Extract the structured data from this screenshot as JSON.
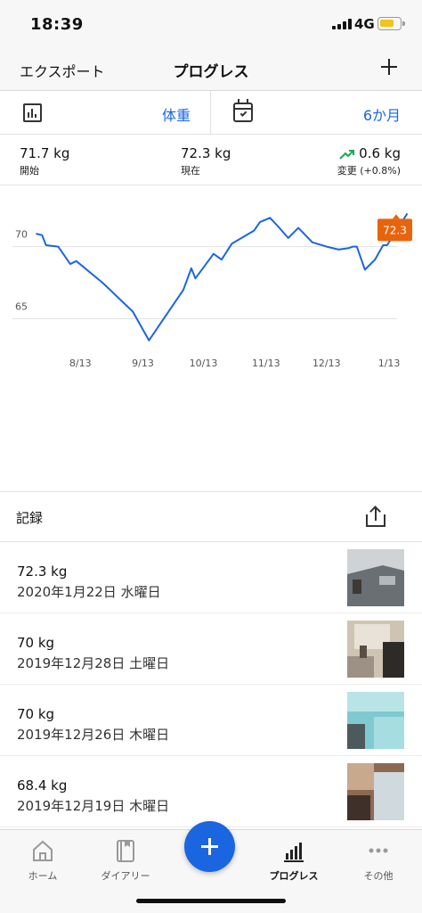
{
  "status_bar": {
    "time": "18:39",
    "network": "4G"
  },
  "navbar": {
    "left_label": "エクスポート",
    "title": "プログレス"
  },
  "filters": {
    "metric": "体重",
    "range": "6か月"
  },
  "stats": {
    "start": {
      "value": "71.7 kg",
      "label": "開始"
    },
    "current": {
      "value": "72.3 kg",
      "label": "現在"
    },
    "change": {
      "value": "0.6 kg",
      "label": "変更 (+0.8%)"
    }
  },
  "chart_data": {
    "type": "line",
    "series": [
      {
        "values": [
          {
            "x": "2019-07-22",
            "y": 70.9
          },
          {
            "x": "2019-07-25",
            "y": 70.8
          },
          {
            "x": "2019-07-27",
            "y": 70.1
          },
          {
            "x": "2019-08-02",
            "y": 70.0
          },
          {
            "x": "2019-08-08",
            "y": 68.8
          },
          {
            "x": "2019-08-11",
            "y": 69.0
          },
          {
            "x": "2019-08-24",
            "y": 67.5
          },
          {
            "x": "2019-09-08",
            "y": 65.5
          },
          {
            "x": "2019-09-16",
            "y": 63.5
          },
          {
            "x": "2019-10-03",
            "y": 67.0
          },
          {
            "x": "2019-10-07",
            "y": 68.5
          },
          {
            "x": "2019-10-09",
            "y": 67.8
          },
          {
            "x": "2019-10-18",
            "y": 69.5
          },
          {
            "x": "2019-10-22",
            "y": 69.1
          },
          {
            "x": "2019-10-27",
            "y": 70.2
          },
          {
            "x": "2019-11-07",
            "y": 71.1
          },
          {
            "x": "2019-11-10",
            "y": 71.7
          },
          {
            "x": "2019-11-15",
            "y": 72.0
          },
          {
            "x": "2019-11-19",
            "y": 71.4
          },
          {
            "x": "2019-11-24",
            "y": 70.6
          },
          {
            "x": "2019-11-29",
            "y": 71.3
          },
          {
            "x": "2019-12-06",
            "y": 70.3
          },
          {
            "x": "2019-12-13",
            "y": 70.0
          },
          {
            "x": "2019-12-19",
            "y": 69.8
          },
          {
            "x": "2019-12-24",
            "y": 69.9
          },
          {
            "x": "2019-12-26",
            "y": 70.0
          },
          {
            "x": "2019-12-28",
            "y": 70.0
          },
          {
            "x": "2020-01-01",
            "y": 68.4
          },
          {
            "x": "2020-01-06",
            "y": 69.1
          },
          {
            "x": "2020-01-10",
            "y": 70.1
          },
          {
            "x": "2020-01-12",
            "y": 70.1
          },
          {
            "x": "2020-01-22",
            "y": 72.3
          }
        ]
      }
    ],
    "x_tick_labels": [
      "8/13",
      "9/13",
      "10/13",
      "11/13",
      "12/13",
      "1/13"
    ],
    "y_ticks": [
      65,
      70
    ],
    "ylim": [
      62.5,
      73.5
    ],
    "last_value_label": "72.3",
    "grid": true,
    "colors": {
      "line": "#1a66e0",
      "last_value_badge": "#e8640c"
    }
  },
  "records": {
    "header": "記録",
    "items": [
      {
        "weight": "72.3 kg",
        "date": "2020年1月22日 水曜日"
      },
      {
        "weight": "70 kg",
        "date": "2019年12月28日 土曜日"
      },
      {
        "weight": "70 kg",
        "date": "2019年12月26日 木曜日"
      },
      {
        "weight": "68.4 kg",
        "date": "2019年12月19日 木曜日"
      }
    ]
  },
  "tabbar": {
    "items": [
      {
        "label": "ホーム"
      },
      {
        "label": "ダイアリー"
      },
      {
        "label": "プログレス"
      },
      {
        "label": "その他"
      }
    ]
  },
  "colors": {
    "accent": "#1a66e0",
    "trend_up": "#1aaa55"
  },
  "icons": [
    "bar-chart-icon",
    "calendar-check-icon",
    "share-icon",
    "plus-icon",
    "home-icon",
    "diary-icon",
    "progress-icon",
    "more-icon",
    "trend-up-icon"
  ]
}
